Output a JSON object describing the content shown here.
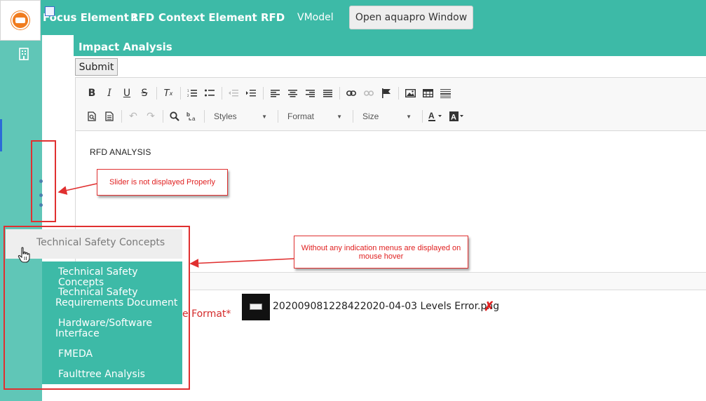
{
  "header": {
    "focus_label": "Focus Element :",
    "focus_value": "RFD",
    "context_label": "Context Element :",
    "context_value": "RFD",
    "vmodel": "VModel",
    "open_window_button": "Open aquapro Window"
  },
  "panel": {
    "title": "Impact Analysis",
    "submit_label": "Submit"
  },
  "toolbar": {
    "row1": [
      {
        "icon": "bold-icon",
        "glyph": "B"
      },
      {
        "icon": "italic-icon",
        "glyph": "I"
      },
      {
        "icon": "underline-icon",
        "glyph": "U"
      },
      {
        "icon": "strikethrough-icon",
        "glyph": "S"
      },
      {
        "icon": "remove-format-icon",
        "glyph": "Tx"
      },
      {
        "icon": "numbered-list-icon",
        "glyph": "≡"
      },
      {
        "icon": "bulleted-list-icon",
        "glyph": "≡"
      },
      {
        "icon": "outdent-icon",
        "glyph": "⇤"
      },
      {
        "icon": "indent-icon",
        "glyph": "⇥"
      },
      {
        "icon": "align-left-icon",
        "glyph": "≡"
      },
      {
        "icon": "align-center-icon",
        "glyph": "≡"
      },
      {
        "icon": "align-right-icon",
        "glyph": "≡"
      },
      {
        "icon": "justify-icon",
        "glyph": "≡"
      },
      {
        "icon": "link-icon",
        "glyph": "⚯"
      },
      {
        "icon": "unlink-icon",
        "glyph": "⚮"
      },
      {
        "icon": "anchor-flag-icon",
        "glyph": "⚑"
      },
      {
        "icon": "image-icon",
        "glyph": "▣"
      },
      {
        "icon": "table-icon",
        "glyph": "▦"
      },
      {
        "icon": "horizontal-line-icon",
        "glyph": "☰"
      }
    ],
    "styles_combo": "Styles",
    "format_combo": "Format",
    "size_combo": "Size"
  },
  "editor": {
    "content": "RFD ANALYSIS"
  },
  "attachment": {
    "format_label": "e Format*",
    "filename": "202009081228422020-04-03 Levels Error.png"
  },
  "menu": {
    "parent_label": "Technical Safety Concepts",
    "items": [
      "Technical Safety Concepts",
      "Technical Safety\nRequirements Document",
      "Hardware/Software\nInterface",
      "FMEDA",
      "Faulttree Analysis"
    ]
  },
  "annotations": {
    "slider_note": "Slider is not displayed Properly",
    "menu_note": "Without any indication menus are displayed on mouse hover"
  },
  "colors": {
    "teal": "#3dbaa7",
    "annotation_red": "#e03030"
  }
}
